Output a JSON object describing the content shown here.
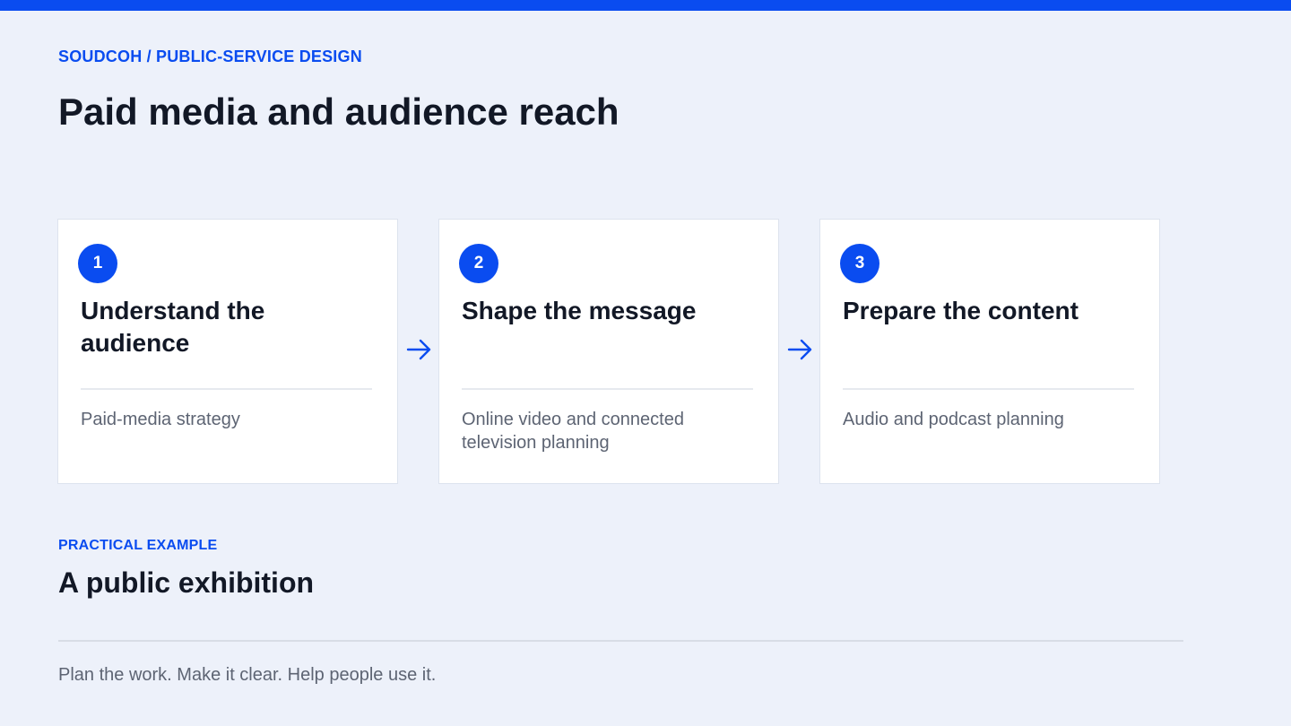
{
  "brand": {
    "breadcrumb": "SOUDCOH / PUBLIC-SERVICE DESIGN",
    "accent_color": "#0a4cf0"
  },
  "page": {
    "title": "Paid media and audience reach"
  },
  "steps": [
    {
      "number": "1",
      "title": "Understand the audience",
      "description": "Paid-media strategy"
    },
    {
      "number": "2",
      "title": "Shape the message",
      "description": "Online video and connected television planning"
    },
    {
      "number": "3",
      "title": "Prepare the content",
      "description": "Audio and podcast planning"
    }
  ],
  "flow_icon": "arrow-right-icon",
  "example": {
    "label": "PRACTICAL EXAMPLE",
    "title": "A public exhibition"
  },
  "footer": {
    "tagline": "Plan the work. Make it clear. Help people use it."
  }
}
